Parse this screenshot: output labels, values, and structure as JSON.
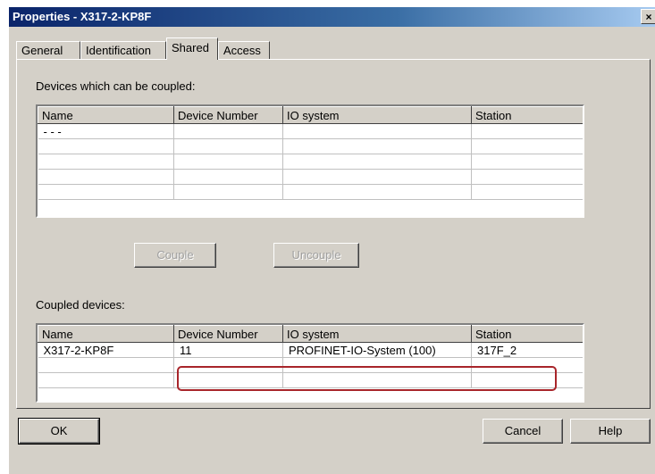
{
  "window": {
    "title": "Properties - X317-2-KP8F",
    "close_glyph": "×"
  },
  "tabs": [
    {
      "label": "General"
    },
    {
      "label": "Identification"
    },
    {
      "label": "Shared",
      "active": true
    },
    {
      "label": "Access"
    }
  ],
  "devices_can_couple": {
    "label": "Devices which can be coupled:",
    "columns": [
      "Name",
      "Device Number",
      "IO system",
      "Station"
    ],
    "rows": [
      [
        "- - -",
        "",
        "",
        ""
      ],
      [
        "",
        "",
        "",
        ""
      ],
      [
        "",
        "",
        "",
        ""
      ],
      [
        "",
        "",
        "",
        ""
      ],
      [
        "",
        "",
        "",
        ""
      ]
    ]
  },
  "actions": {
    "couple": "Couple",
    "uncouple": "Uncouple"
  },
  "coupled_devices": {
    "label": "Coupled devices:",
    "columns": [
      "Name",
      "Device Number",
      "IO system",
      "Station"
    ],
    "rows": [
      [
        "X317-2-KP8F",
        "11",
        "PROFINET-IO-System (100)",
        "317F_2"
      ],
      [
        "",
        "",
        "",
        ""
      ],
      [
        "",
        "",
        "",
        ""
      ]
    ],
    "highlight_color": "#a8252a"
  },
  "footer": {
    "ok": "OK",
    "cancel": "Cancel",
    "help": "Help"
  }
}
